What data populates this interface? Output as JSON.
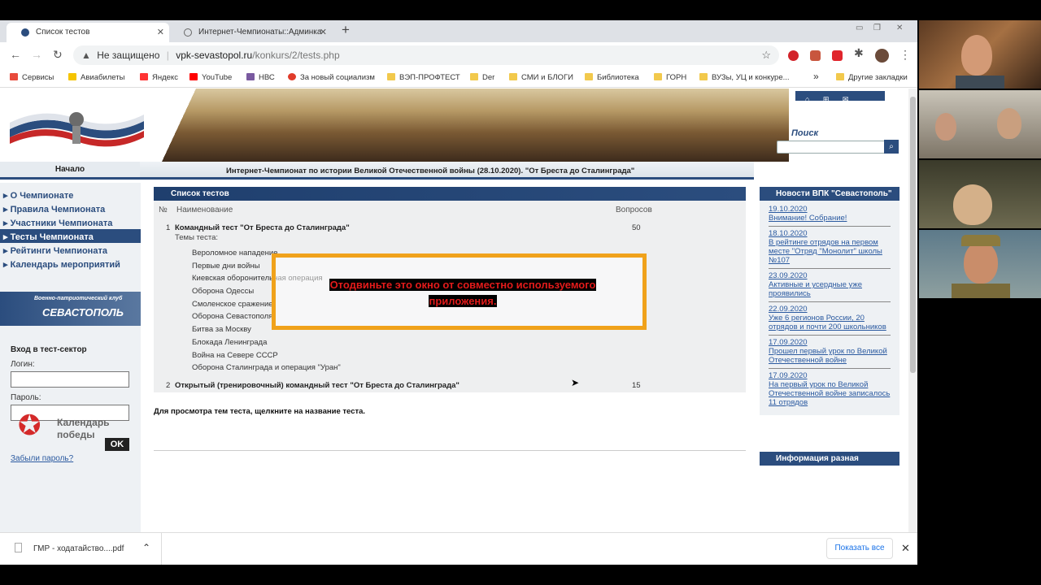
{
  "browser": {
    "tabs": [
      {
        "title": "Список тестов",
        "active": true
      },
      {
        "title": "Интернет-Чемпионаты::Админка",
        "active": false
      }
    ],
    "new_tab": "+",
    "not_secure": "Не защищено",
    "url_host": "vpk-sevastopol.ru",
    "url_path": "/konkurs/2/tests.php",
    "bookmarks": [
      {
        "label": "Сервисы",
        "color": "#e84b3c"
      },
      {
        "label": "Авиабилеты",
        "color": "#f5c400"
      },
      {
        "label": "Яндекс",
        "color": "#ff3333"
      },
      {
        "label": "YouTube",
        "color": "#ff0000"
      },
      {
        "label": "НВС",
        "color": "#7a5aa0"
      },
      {
        "label": "За новый социализм",
        "color": "#e03b2a"
      },
      {
        "label": "ВЭП-ПРОФТЕСТ",
        "color": "#f2c94c"
      },
      {
        "label": "Der",
        "color": "#f2c94c"
      },
      {
        "label": "СМИ и БЛОГИ",
        "color": "#f2c94c"
      },
      {
        "label": "Библиотека",
        "color": "#f2c94c"
      },
      {
        "label": "ГОРН",
        "color": "#f2c94c"
      },
      {
        "label": "ВУЗы, УЦ и конкуре...",
        "color": "#f2c94c"
      }
    ],
    "bookmarks_more": "»",
    "other_bookmarks": "Другие закладки"
  },
  "site": {
    "search_title": "Поиск",
    "nav_start": "Начало",
    "page_heading": "Интернет-Чемпионат по истории Великой Отечественной войны (28.10.2020). \"От Бреста до Сталинграда\"",
    "menu": [
      {
        "label": "О Чемпионате",
        "active": false
      },
      {
        "label": "Правила Чемпионата",
        "active": false
      },
      {
        "label": "Участники Чемпионата",
        "active": false
      },
      {
        "label": "Тесты Чемпионата",
        "active": true
      },
      {
        "label": "Рейтинги Чемпионата",
        "active": false
      },
      {
        "label": "Календарь мероприятий",
        "active": false
      }
    ],
    "club_small": "Военно-патриотический клуб",
    "club_big": "СЕВАСТОПОЛЬ",
    "login": {
      "heading": "Вход в тест-сектор",
      "login_label": "Логин:",
      "password_label": "Пароль:",
      "ok": "OK",
      "forgot": "Забыли пароль?"
    },
    "calendar_line1": "Календарь",
    "calendar_line2": "победы"
  },
  "tests": {
    "section_title": "Список тестов",
    "col_num": "№",
    "col_name": "Наименование",
    "col_questions": "Вопросов",
    "rows": [
      {
        "num": "1",
        "name": "Командный тест \"От Бреста до Сталинграда\"",
        "questions": "50",
        "topics_label": "Темы теста:",
        "topics": [
          "Вероломное нападение",
          "Первые дни войны",
          "Киевская оборонительная операция",
          "Оборона Одессы",
          "Смоленское сражение",
          "Оборона Севастополя",
          "Битва за Москву",
          "Блокада Ленинграда",
          "Война на Севере СССР",
          "Оборона Сталинграда и операция \"Уран\""
        ]
      },
      {
        "num": "2",
        "name": "Открытый (тренировочный) командный тест \"От Бреста до Сталинграда\"",
        "questions": "15"
      }
    ],
    "note": "Для просмотра тем теста, щелкните на название теста."
  },
  "overlay": {
    "line1": "Отодвиньте это окно от совместно используемого",
    "line2": "приложения."
  },
  "news": {
    "title": "Новости ВПК \"Севастополь\"",
    "items": [
      {
        "date": "19.10.2020",
        "text": "Внимание! Собрание!"
      },
      {
        "date": "18.10.2020",
        "text": "В рейтинге отрядов на первом месте \"Отряд \"Монолит\" школы №107"
      },
      {
        "date": "23.09.2020",
        "text": "Активные и усердные уже проявились"
      },
      {
        "date": "22.09.2020",
        "text": "Уже 6 регионов России, 20 отрядов и почти 200 школьников"
      },
      {
        "date": "17.09.2020",
        "text": "Прошел первый урок по Великой Отечественной войне"
      },
      {
        "date": "17.09.2020",
        "text": "На первый урок по Великой Отечественной войне записалось 11 отрядов"
      }
    ],
    "info_title": "Информация разная"
  },
  "download": {
    "file": "ГМР - ходатайство....pdf",
    "show_all": "Показать все"
  }
}
